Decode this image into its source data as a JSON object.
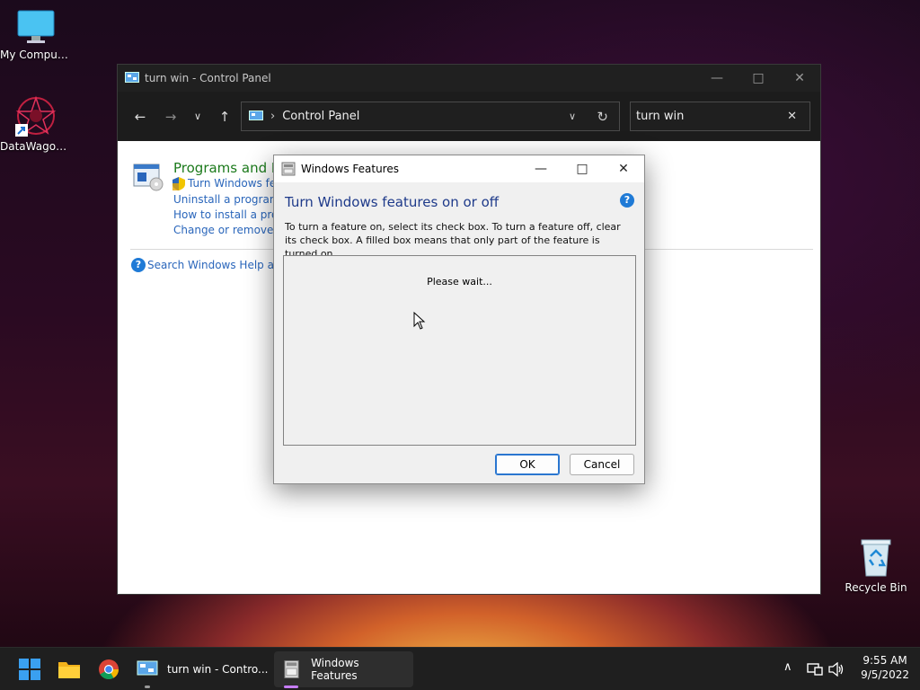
{
  "desktop": {
    "icons": [
      {
        "label": "My Computer"
      },
      {
        "label": "DataWagon..."
      },
      {
        "label": "Recycle Bin"
      }
    ]
  },
  "control_panel": {
    "title": "turn win - Control Panel",
    "address": "Control Panel",
    "search_value": "turn win",
    "section_title": "Programs and Fe",
    "links": [
      "Turn Windows featu",
      "Uninstall a program",
      "How to install a progra",
      "Change or remove a p"
    ],
    "help_link": "Search Windows Help and"
  },
  "dialog": {
    "title": "Windows Features",
    "heading": "Turn Windows features on or off",
    "description": "To turn a feature on, select its check box. To turn a feature off, clear its check box. A filled box means that only part of the feature is turned on.",
    "loading_text": "Please wait...",
    "ok_label": "OK",
    "cancel_label": "Cancel",
    "help_glyph": "?"
  },
  "taskbar": {
    "apps": [
      {
        "label": "turn win - Contro..."
      },
      {
        "label": "Windows Features"
      }
    ],
    "time": "9:55 AM",
    "date": "9/5/2022"
  },
  "colors": {
    "link": "#2a66bb",
    "dialog_heading": "#1e3a8a",
    "section_title": "#1c7a1c",
    "accent": "#2a76d0"
  }
}
